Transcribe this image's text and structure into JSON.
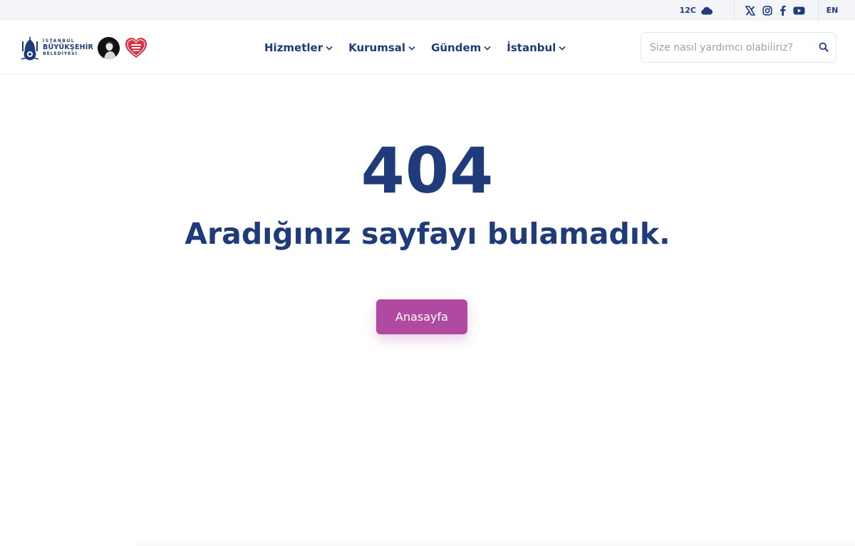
{
  "topbar": {
    "temperature": "12C",
    "weather_icon": "cloud-icon",
    "social_icons": [
      "x-twitter-icon",
      "instagram-icon",
      "facebook-icon",
      "youtube-icon"
    ],
    "language": "EN"
  },
  "header": {
    "logo": {
      "line1": "İSTANBUL",
      "line2": "BÜYÜKŞEHİR",
      "line3": "BELEDİYESİ"
    },
    "nav": [
      {
        "label": "Hizmetler"
      },
      {
        "label": "Kurumsal"
      },
      {
        "label": "Gündem"
      },
      {
        "label": "İstanbul"
      }
    ],
    "search": {
      "placeholder": "Size nasıl yardımcı olabiliriz?",
      "value": ""
    }
  },
  "main": {
    "code": "404",
    "message": "Aradığınız sayfayı bulamadık.",
    "home_button": "Anasayfa"
  },
  "colors": {
    "primary": "#1f3b7a",
    "accent": "#b04aa1",
    "topbar_bg": "#f3f5f9",
    "heart_red": "#d63344"
  }
}
